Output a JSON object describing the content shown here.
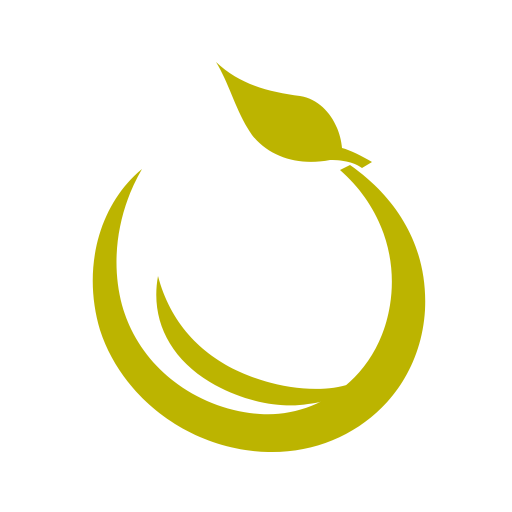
{
  "icon": {
    "name": "sprout-swirl-logo-icon",
    "brand_color": "#bcb400",
    "background_color": "#ffffff"
  }
}
